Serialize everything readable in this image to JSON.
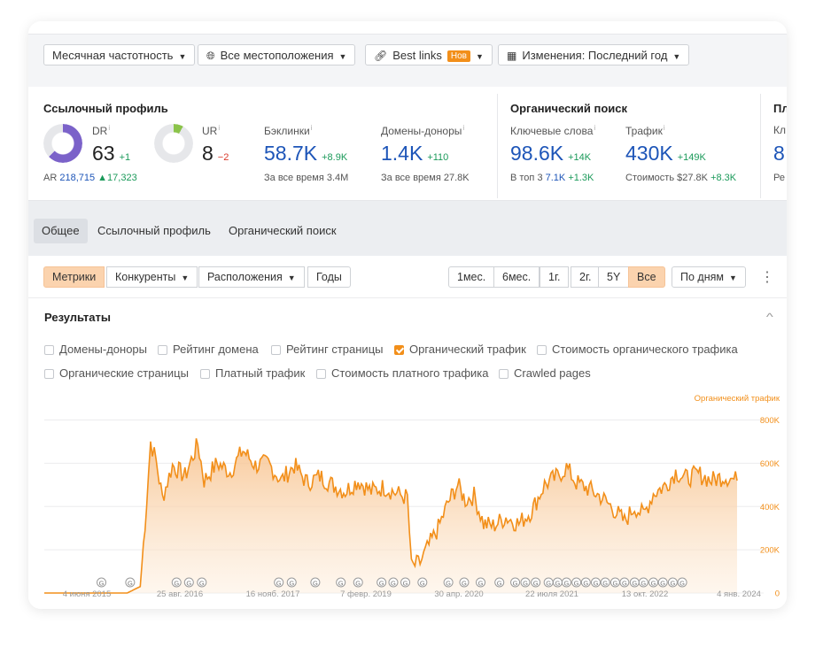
{
  "toolbar": {
    "frequency": "Месячная частотность",
    "locations": "Все местоположения",
    "best_links": "Best links",
    "best_links_badge": "Нов",
    "changes": "Изменения: Последний год"
  },
  "metrics": {
    "backlink_profile_title": "Ссылочный профиль",
    "organic_title": "Органический поиск",
    "third_title": "Пл",
    "dr": {
      "label": "DR",
      "value": "63",
      "delta": "+1",
      "fill_fraction": 0.63
    },
    "ar": {
      "label": "AR",
      "value": "218,715",
      "delta": "▲17,323"
    },
    "ur": {
      "label": "UR",
      "value": "8",
      "delta": "−2",
      "fill_fraction": 0.08
    },
    "backlinks": {
      "label": "Бэклинки",
      "value": "58.7K",
      "delta": "+8.9K",
      "sub_label": "За все время",
      "sub_value": "3.4M"
    },
    "ref_domains": {
      "label": "Домены-доноры",
      "value": "1.4K",
      "delta": "+110",
      "sub_label": "За все время",
      "sub_value": "27.8K"
    },
    "keywords": {
      "label": "Ключевые слова",
      "value": "98.6K",
      "delta": "+14K",
      "sub_label": "В топ 3",
      "sub_value": "7.1K",
      "sub_delta": "+1.3K"
    },
    "traffic": {
      "label": "Трафик",
      "value": "430K",
      "delta": "+149K",
      "sub_label": "Стоимость",
      "sub_value": "$27.8K",
      "sub_delta": "+8.3K"
    },
    "third": {
      "label": "Кл",
      "value": "8",
      "sub_label": "Ре"
    },
    "info_mark": "i"
  },
  "tabs": [
    "Общее",
    "Ссылочный профиль",
    "Органический поиск"
  ],
  "controls": {
    "views": [
      "Метрики",
      "Конкуренты",
      "Расположения",
      "Годы"
    ],
    "ranges": [
      "1мес.",
      "6мес.",
      "1г.",
      "2г.",
      "5Y",
      "Все"
    ],
    "interval": "По дням",
    "more": "⋮"
  },
  "results": {
    "title": "Результаты",
    "collapse": "^",
    "checkboxes": [
      {
        "label": "Домены-доноры",
        "checked": false
      },
      {
        "label": "Рейтинг домена",
        "checked": false
      },
      {
        "label": "Рейтинг страницы",
        "checked": false
      },
      {
        "label": "Органический трафик",
        "checked": true
      },
      {
        "label": "Стоимость органического трафика",
        "checked": false
      },
      {
        "label": "Органические страницы",
        "checked": false
      },
      {
        "label": "Платный трафик",
        "checked": false
      },
      {
        "label": "Стоимость платного трафика",
        "checked": false
      },
      {
        "label": "Crawled pages",
        "checked": false
      }
    ]
  },
  "colors": {
    "accent": "#f28f1a",
    "blue": "#1d55b8",
    "donut_dr": "#7b62c9",
    "donut_ur": "#8bc34a"
  },
  "chart_data": {
    "type": "area",
    "series_name": "Органический трафик",
    "y_ticks": [
      "0",
      "200K",
      "400K",
      "600K",
      "800K"
    ],
    "ylim": [
      0,
      880000
    ],
    "x_ticks": [
      "4 июня 2015",
      "25 авг. 2016",
      "16 нояб. 2017",
      "7 февр. 2019",
      "30 апр. 2020",
      "22 июля 2021",
      "13 окт. 2022",
      "4 янв. 2024"
    ],
    "x_range": [
      "2015-06-04",
      "2024-06-01"
    ],
    "points": [
      [
        "2015-06-04",
        0
      ],
      [
        "2016-07-01",
        0
      ],
      [
        "2016-09-01",
        30000
      ],
      [
        "2016-10-01",
        420000
      ],
      [
        "2016-10-20",
        700000
      ],
      [
        "2016-11-15",
        610000
      ],
      [
        "2016-12-15",
        440000
      ],
      [
        "2017-02-01",
        590000
      ],
      [
        "2017-04-01",
        540000
      ],
      [
        "2017-06-01",
        690000
      ],
      [
        "2017-07-01",
        520000
      ],
      [
        "2017-09-01",
        600000
      ],
      [
        "2017-11-01",
        560000
      ],
      [
        "2018-01-01",
        660000
      ],
      [
        "2018-03-01",
        590000
      ],
      [
        "2018-05-01",
        600000
      ],
      [
        "2018-07-01",
        520000
      ],
      [
        "2018-09-01",
        590000
      ],
      [
        "2018-11-01",
        510000
      ],
      [
        "2019-01-01",
        540000
      ],
      [
        "2019-03-01",
        500000
      ],
      [
        "2019-05-01",
        470000
      ],
      [
        "2019-07-01",
        520000
      ],
      [
        "2019-09-01",
        470000
      ],
      [
        "2019-11-01",
        490000
      ],
      [
        "2020-01-01",
        460000
      ],
      [
        "2020-02-20",
        440000
      ],
      [
        "2020-03-10",
        120000
      ],
      [
        "2020-04-20",
        140000
      ],
      [
        "2020-06-01",
        220000
      ],
      [
        "2020-07-15",
        300000
      ],
      [
        "2020-09-01",
        420000
      ],
      [
        "2020-10-15",
        500000
      ],
      [
        "2020-11-20",
        430000
      ],
      [
        "2021-01-01",
        450000
      ],
      [
        "2021-02-15",
        320000
      ],
      [
        "2021-04-01",
        310000
      ],
      [
        "2021-06-01",
        350000
      ],
      [
        "2021-08-01",
        320000
      ],
      [
        "2021-10-01",
        380000
      ],
      [
        "2021-12-01",
        500000
      ],
      [
        "2022-02-01",
        540000
      ],
      [
        "2022-03-15",
        580000
      ],
      [
        "2022-05-01",
        510000
      ],
      [
        "2022-07-01",
        480000
      ],
      [
        "2022-09-01",
        440000
      ],
      [
        "2022-11-01",
        380000
      ],
      [
        "2022-12-15",
        330000
      ],
      [
        "2023-02-01",
        400000
      ],
      [
        "2023-03-15",
        360000
      ],
      [
        "2023-05-01",
        460000
      ],
      [
        "2023-07-01",
        500000
      ],
      [
        "2023-08-15",
        560000
      ],
      [
        "2023-10-01",
        530000
      ],
      [
        "2023-12-01",
        550000
      ],
      [
        "2024-02-01",
        520000
      ],
      [
        "2024-04-01",
        540000
      ],
      [
        "2024-06-01",
        520000
      ]
    ],
    "annotation_marker": "G",
    "annotation_dates": [
      "2016-03-01",
      "2016-07-15",
      "2017-02-20",
      "2017-04-20",
      "2017-06-20",
      "2018-06-20",
      "2018-08-20",
      "2018-12-10",
      "2019-04-10",
      "2019-07-01",
      "2019-10-20",
      "2019-12-15",
      "2020-02-10",
      "2020-05-01",
      "2020-09-01",
      "2020-11-15",
      "2021-02-01",
      "2021-05-01",
      "2021-07-15",
      "2021-09-01",
      "2021-10-20",
      "2021-12-20",
      "2022-02-01",
      "2022-03-15",
      "2022-05-01",
      "2022-06-15",
      "2022-08-01",
      "2022-09-15",
      "2022-11-01",
      "2022-12-15",
      "2023-02-01",
      "2023-03-15",
      "2023-05-01",
      "2023-06-15",
      "2023-08-01",
      "2023-09-15"
    ]
  }
}
